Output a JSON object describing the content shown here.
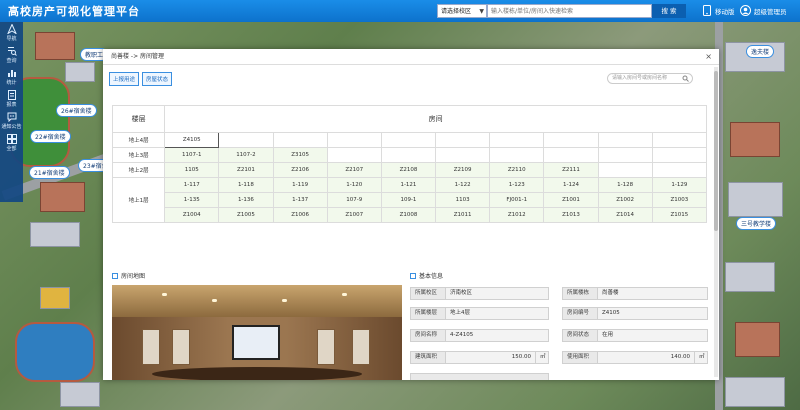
{
  "app_title": "高校房产可视化管理平台",
  "header": {
    "campus_select": "请选择校区",
    "search_placeholder": "输入楼栋/单位/房间入快速检索",
    "search_button": "搜 索",
    "mobile_label": "移动版",
    "user_label": "超级管理员"
  },
  "sidebar": {
    "items": [
      {
        "label": "导航",
        "icon": "compass-icon"
      },
      {
        "label": "查询",
        "icon": "search-list-icon"
      },
      {
        "label": "统计",
        "icon": "bar-chart-icon"
      },
      {
        "label": "报表",
        "icon": "report-icon"
      },
      {
        "label": "通知公告",
        "icon": "message-icon"
      },
      {
        "label": "全部",
        "icon": "grid-icon"
      }
    ]
  },
  "map_tags": [
    "教职工",
    "26#宿舍楼",
    "22#宿舍楼",
    "23#宿舍",
    "21#宿舍楼",
    "逸夫楼",
    "三号教学楼"
  ],
  "modal": {
    "breadcrumb": "尚善楼 -> 房间管理",
    "close": "×",
    "buttons": [
      "上报用途",
      "房屋状态"
    ],
    "search_placeholder": "请输入房间号或房间名称",
    "table": {
      "col_floor": "楼层",
      "col_rooms": "房间",
      "floors": [
        {
          "label": "地上4层",
          "rooms": [
            "Z4105"
          ]
        },
        {
          "label": "地上3层",
          "rooms": [
            "1107-1",
            "1107-2",
            "Z3105"
          ]
        },
        {
          "label": "地上2层",
          "rooms": [
            "1105",
            "Z2101",
            "Z2106",
            "Z2107",
            "Z2108",
            "Z2109",
            "Z2110",
            "Z2111"
          ]
        },
        {
          "label": "地上1层",
          "rows": [
            [
              "1-117",
              "1-118",
              "1-119",
              "1-120",
              "1-121",
              "1-122",
              "1-123",
              "1-124",
              "1-128",
              "1-129"
            ],
            [
              "1-135",
              "1-136",
              "1-137",
              "107-9",
              "109-1",
              "1103",
              "FJ001-1",
              "Z1001",
              "Z1002",
              "Z1003"
            ],
            [
              "Z1004",
              "Z1005",
              "Z1006",
              "Z1007",
              "Z1008",
              "Z1011",
              "Z1012",
              "Z1013",
              "Z1014",
              "Z1015"
            ]
          ]
        }
      ]
    },
    "photo_title": "房间地图",
    "info_title": "基本信息",
    "info": {
      "campus_label": "所属校区",
      "campus_value": "济南校区",
      "building_label": "所属楼栋",
      "building_value": "尚善楼",
      "floor_label": "所属楼层",
      "floor_value": "地上4层",
      "room_no_label": "房间编号",
      "room_no_value": "Z4105",
      "room_name_label": "房间名称",
      "room_name_value": "4-Z4105",
      "status_label": "房间状态",
      "status_value": "在用",
      "area_label": "建筑面积",
      "area_value": "150.00",
      "area_unit": "㎡",
      "use_area_label": "使用面积",
      "use_area_value": "140.00",
      "use_area_unit": "㎡"
    }
  }
}
